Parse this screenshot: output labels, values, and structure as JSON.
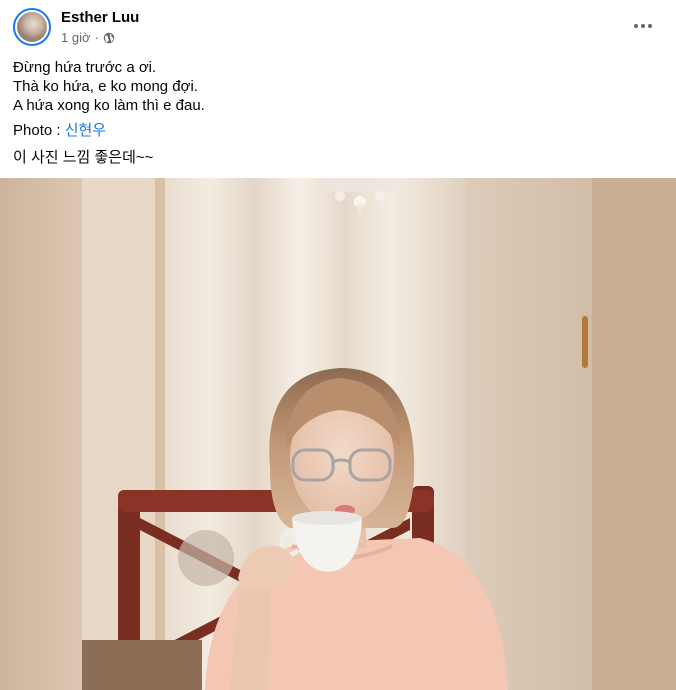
{
  "post": {
    "author": "Esther Luu",
    "timestamp": "1 giờ",
    "separator": "·",
    "privacy_icon": "globe-icon",
    "more_icon": "more-horizontal-icon",
    "caption_lines": [
      "Đừng hứa trước a ơi.",
      "Thà ko hứa, e ko mong đợi.",
      "A hứa xong ko làm thì e đau."
    ],
    "photo_credit_label": "Photo : ",
    "photo_credit_name": "신현우",
    "korean_line": "이 사진 느낌 좋은데~~"
  },
  "colors": {
    "link": "#1877f2",
    "secondary_text": "#65676b",
    "avatar_ring": "#1877f2"
  }
}
